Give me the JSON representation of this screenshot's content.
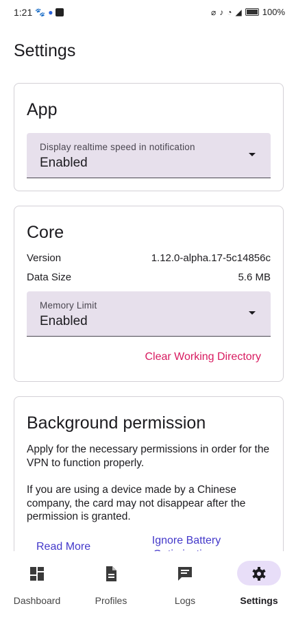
{
  "status_bar": {
    "time": "1:21",
    "battery": "100%",
    "icons_left": [
      "paw-icon",
      "person-icon",
      "app-icon"
    ],
    "icons_right": [
      "key-icon",
      "mute-icon",
      "wifi-icon",
      "signal-icon",
      "battery-icon"
    ]
  },
  "page": {
    "title": "Settings"
  },
  "app_card": {
    "title": "App",
    "dropdown": {
      "label": "Display realtime speed in notification",
      "value": "Enabled"
    }
  },
  "core_card": {
    "title": "Core",
    "version_label": "Version",
    "version_value": "1.12.0-alpha.17-5c14856c",
    "data_size_label": "Data Size",
    "data_size_value": "5.6 MB",
    "dropdown": {
      "label": "Memory Limit",
      "value": "Enabled"
    },
    "clear_button": "Clear Working Directory"
  },
  "background_card": {
    "title": "Background permission",
    "paragraph1": "Apply for the necessary permissions in order for the VPN to function properly.",
    "paragraph2": "If you are using a device made by a Chinese company, the card may not disappear after the permission is granted.",
    "read_more": "Read More",
    "ignore_battery": "Ignore Battery Optimizations"
  },
  "bottom_nav": {
    "items": [
      {
        "label": "Dashboard",
        "icon": "dashboard-icon",
        "active": false
      },
      {
        "label": "Profiles",
        "icon": "document-icon",
        "active": false
      },
      {
        "label": "Logs",
        "icon": "chat-icon",
        "active": false
      },
      {
        "label": "Settings",
        "icon": "gear-icon",
        "active": true
      }
    ]
  },
  "colors": {
    "accent_pink": "#d81b60",
    "link_blue": "#4338ca",
    "field_bg": "#e7e0ec",
    "nav_active_pill": "#e8def8"
  }
}
